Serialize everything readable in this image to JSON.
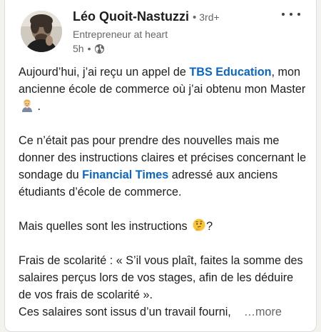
{
  "author": {
    "name": "Léo Quoit-Nastuzzi",
    "separator": "•",
    "degree": "3rd+",
    "headline": "Entrepreneur at heart",
    "time": "5h",
    "meta_separator": "•",
    "visibility_icon": "globe-icon",
    "avatar_icon": "profile-photo"
  },
  "menu": {
    "icon": "more-horizontal-icon"
  },
  "post": {
    "p1": {
      "before": "Aujourd’hui, j’ai reçu un appel de ",
      "link": "TBS Education",
      "after": ", mon ancienne école de commerce où j’ai obtenu mon Master",
      "emoji": "man-office-worker-emoji",
      "tail": " ."
    },
    "p2": {
      "before": "Ce n’était pas pour prendre des nouvelles mais me donner des instructions claires et précises concernant le sondage du ",
      "link": "Financial Times",
      "after": " adressé aux anciens étudiants d’école de commerce."
    },
    "p3": {
      "text": "Mais quelles sont les instructions",
      "emoji": "thinking-face-emoji",
      "tail": "?"
    },
    "p4": {
      "line1": "Frais de scolarité : « S’il vous plaît, faites la somme des salaires perçus lors de vos stages, afin de les déduire de vos frais de scolarité ».",
      "line2": "Ces salaires sont issus d’un travail fourni,",
      "see_more": "…more"
    }
  },
  "colors": {
    "link": "#0a66c2",
    "text": "#1d1d1d",
    "secondary": "#666666"
  }
}
